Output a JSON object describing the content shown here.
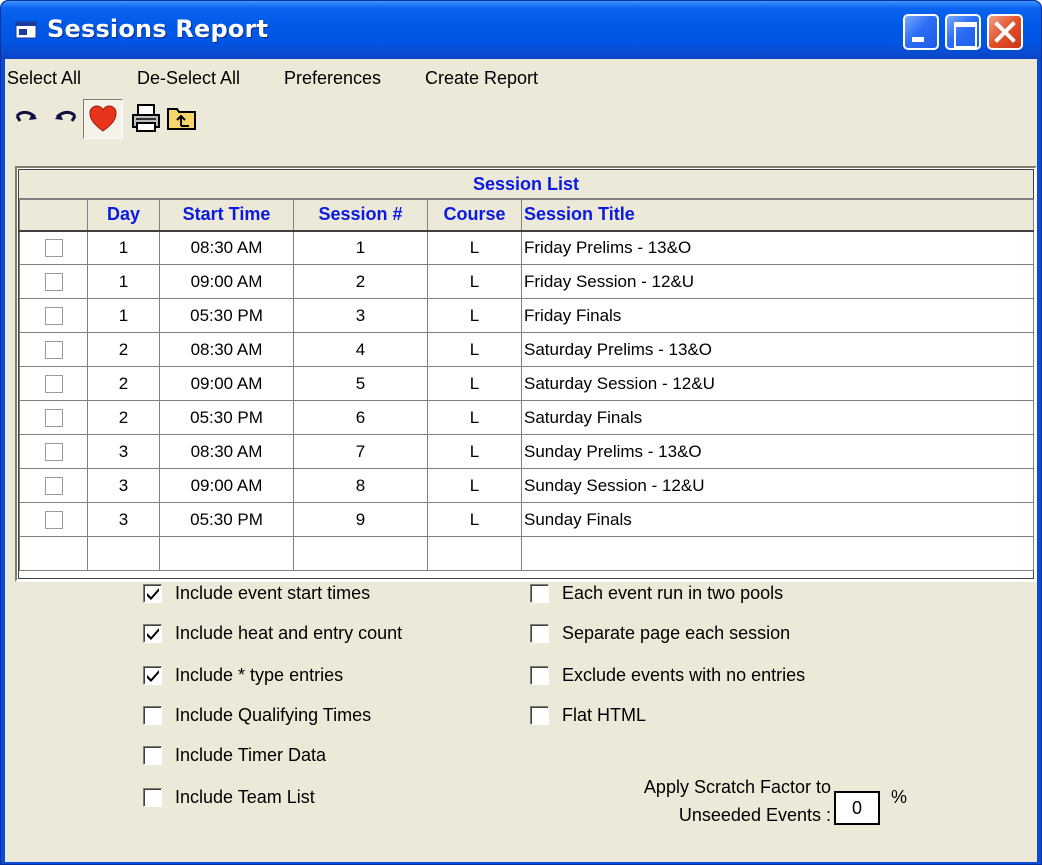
{
  "window": {
    "title": "Sessions Report"
  },
  "menu": [
    "Select All",
    "De-Select All",
    "Preferences",
    "Create Report"
  ],
  "toolbar": {
    "icons": [
      "redo-icon",
      "undo-icon",
      "heart-icon",
      "printer-icon",
      "folder-up-icon"
    ]
  },
  "grid": {
    "title": "Session List",
    "columns": [
      "",
      "Day",
      "Start Time",
      "Session #",
      "Course",
      "Session Title"
    ],
    "rows": [
      {
        "day": "1",
        "start": "08:30 AM",
        "session": "1",
        "course": "L",
        "title": "Friday Prelims - 13&O"
      },
      {
        "day": "1",
        "start": "09:00 AM",
        "session": "2",
        "course": "L",
        "title": "Friday Session - 12&U"
      },
      {
        "day": "1",
        "start": "05:30 PM",
        "session": "3",
        "course": "L",
        "title": "Friday Finals"
      },
      {
        "day": "2",
        "start": "08:30 AM",
        "session": "4",
        "course": "L",
        "title": "Saturday Prelims - 13&O"
      },
      {
        "day": "2",
        "start": "09:00 AM",
        "session": "5",
        "course": "L",
        "title": "Saturday Session - 12&U"
      },
      {
        "day": "2",
        "start": "05:30 PM",
        "session": "6",
        "course": "L",
        "title": "Saturday Finals"
      },
      {
        "day": "3",
        "start": "08:30 AM",
        "session": "7",
        "course": "L",
        "title": "Sunday Prelims - 13&O"
      },
      {
        "day": "3",
        "start": "09:00 AM",
        "session": "8",
        "course": "L",
        "title": "Sunday Session - 12&U"
      },
      {
        "day": "3",
        "start": "05:30 PM",
        "session": "9",
        "course": "L",
        "title": "Sunday Finals"
      }
    ]
  },
  "options": {
    "left": [
      {
        "label": "Include event start times",
        "checked": true
      },
      {
        "label": "Include heat and entry count",
        "checked": true
      },
      {
        "label": "Include * type entries",
        "checked": true
      },
      {
        "label": "Include Qualifying Times",
        "checked": false
      },
      {
        "label": "Include Timer Data",
        "checked": false
      },
      {
        "label": "Include Team List",
        "checked": false
      }
    ],
    "right": [
      {
        "label": "Each event run in two pools",
        "checked": false
      },
      {
        "label": "Separate page each session",
        "checked": false
      },
      {
        "label": "Exclude events with no entries",
        "checked": false
      },
      {
        "label": "Flat HTML",
        "checked": false
      }
    ]
  },
  "scratch": {
    "label_line1": "Apply Scratch Factor to",
    "label_line2": "Unseeded Events :",
    "value": "0",
    "unit": "%"
  },
  "colors": {
    "header_text": "#0a1ae0",
    "face": "#ece9d8",
    "title_bar": "#0058e6"
  }
}
